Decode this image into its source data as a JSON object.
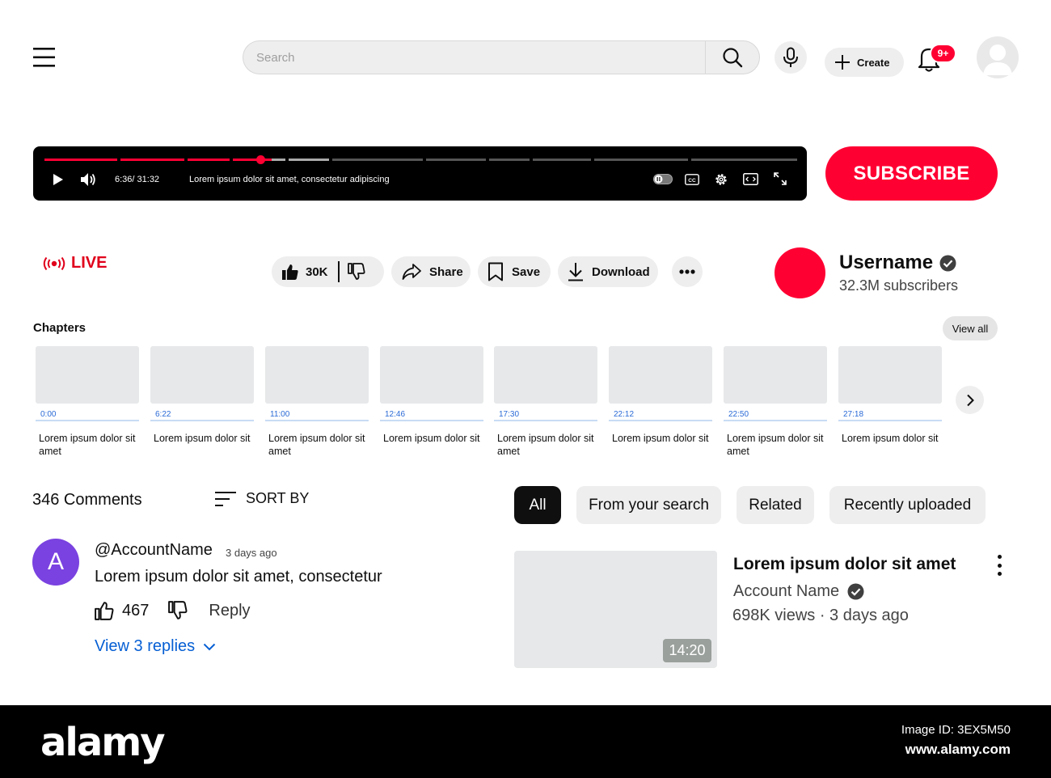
{
  "header": {
    "search_placeholder": "Search",
    "create_label": "Create",
    "notification_badge": "9+"
  },
  "player": {
    "time": "6:36/ 31:32",
    "title": "Lorem ipsum dolor sit amet, consectetur adipiscing",
    "progress_fraction": 0.29
  },
  "subscribe_label": "SUBSCRIBE",
  "live_label": "LIVE",
  "actions": {
    "like_count": "30K",
    "share_label": "Share",
    "save_label": "Save",
    "download_label": "Download"
  },
  "channel": {
    "name": "Username",
    "subscribers": "32.3M subscribers",
    "avatar_color": "#ff0033"
  },
  "chapters": {
    "title": "Chapters",
    "view_all": "View all",
    "items": [
      {
        "time": "0:00",
        "label": "Lorem ipsum dolor sit amet"
      },
      {
        "time": "6:22",
        "label": "Lorem ipsum dolor sit"
      },
      {
        "time": "11:00",
        "label": "Lorem ipsum dolor sit amet"
      },
      {
        "time": "12:46",
        "label": "Lorem ipsum dolor sit"
      },
      {
        "time": "17:30",
        "label": "Lorem ipsum dolor sit amet"
      },
      {
        "time": "22:12",
        "label": "Lorem ipsum dolor sit"
      },
      {
        "time": "22:50",
        "label": "Lorem ipsum dolor sit amet"
      },
      {
        "time": "27:18",
        "label": "Lorem ipsum dolor sit"
      }
    ]
  },
  "comments": {
    "count_label": "346 Comments",
    "sort_label": "SORT BY",
    "item": {
      "avatar_letter": "A",
      "author": "@AccountName",
      "time": "3 days ago",
      "text": "Lorem ipsum dolor sit amet, consectetur",
      "likes": "467",
      "reply_label": "Reply",
      "view_replies": "View 3 replies"
    }
  },
  "filters": {
    "chips": [
      "All",
      "From your search",
      "Related",
      "Recently uploaded"
    ]
  },
  "related_video": {
    "title": "Lorem ipsum dolor sit amet",
    "channel": "Account Name",
    "meta": "698K views · 3 days ago",
    "duration": "14:20"
  },
  "footer": {
    "logo": "alamy",
    "image_id": "Image ID: 3EX5M50",
    "url": "www.alamy.com"
  },
  "colors": {
    "accent_red": "#ff0033",
    "link_blue": "#065fd4",
    "comment_avatar": "#7a42e0"
  },
  "icons": [
    "menu-icon",
    "search-icon",
    "mic-icon",
    "plus-icon",
    "bell-icon",
    "user-icon",
    "play-icon",
    "volume-icon",
    "autoplay-toggle-icon",
    "cc-icon",
    "gear-icon",
    "miniplayer-icon",
    "fullscreen-icon",
    "live-icon",
    "thumbs-up-icon",
    "thumbs-down-icon",
    "share-icon",
    "bookmark-icon",
    "download-icon",
    "more-horizontal-icon",
    "verified-icon",
    "chevron-right-icon",
    "sort-icon",
    "chevron-down-icon",
    "more-vertical-icon"
  ]
}
